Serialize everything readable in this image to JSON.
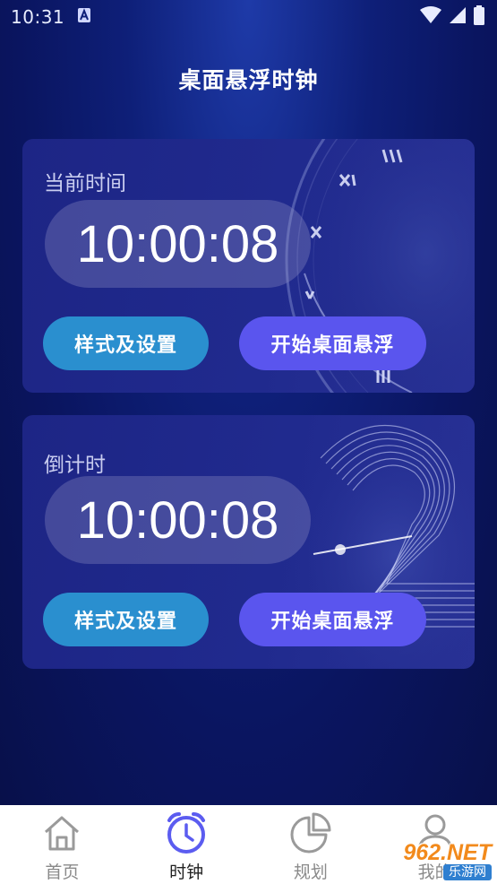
{
  "status_bar": {
    "time": "10:31",
    "icons": [
      "notification-a-icon",
      "wifi-icon",
      "cellular-icon",
      "battery-icon"
    ]
  },
  "header": {
    "title": "桌面悬浮时钟"
  },
  "cards": [
    {
      "label": "当前时间",
      "time": "10:00:08",
      "settings_label": "样式及设置",
      "float_label": "开始桌面悬浮",
      "decoration": "roman-clock-face"
    },
    {
      "label": "倒计时",
      "time": "10:00:08",
      "settings_label": "样式及设置",
      "float_label": "开始桌面悬浮",
      "decoration": "number-2-graphic"
    }
  ],
  "tabs": [
    {
      "label": "首页",
      "icon": "home-icon",
      "active": false
    },
    {
      "label": "时钟",
      "icon": "alarm-clock-icon",
      "active": true
    },
    {
      "label": "规划",
      "icon": "pie-chart-icon",
      "active": false
    },
    {
      "label": "我的",
      "icon": "user-icon",
      "active": false
    }
  ],
  "watermark": {
    "top": "962.NET",
    "bottom": "乐游网"
  },
  "colors": {
    "background": "#0e1f78",
    "card": "#1f288b",
    "settings_button": "#2a8fcf",
    "float_button": "#5a55ee",
    "tab_active": "#5b5cf0",
    "tab_inactive": "#9a9a9a"
  }
}
